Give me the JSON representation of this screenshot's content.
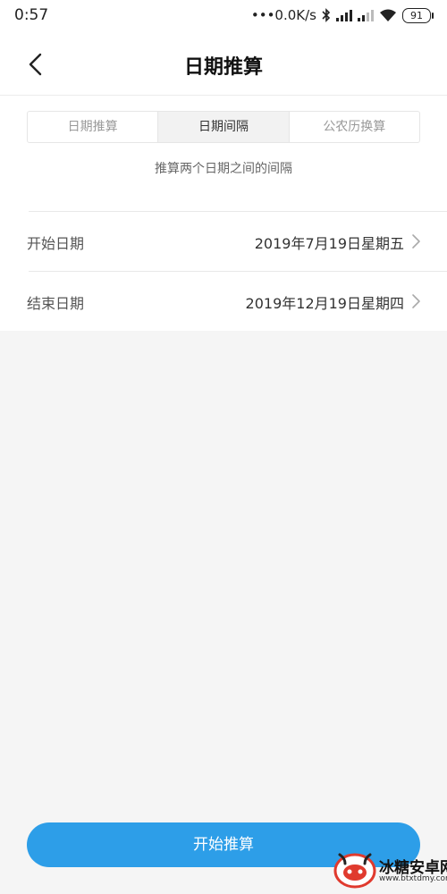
{
  "status_bar": {
    "time": "0:57",
    "speed": "•••0.0K/s",
    "battery": "91"
  },
  "header": {
    "title": "日期推算"
  },
  "tabs": [
    {
      "label": "日期推算",
      "active": false
    },
    {
      "label": "日期间隔",
      "active": true
    },
    {
      "label": "公农历换算",
      "active": false
    }
  ],
  "subtitle": "推算两个日期之间的间隔",
  "rows": {
    "start": {
      "label": "开始日期",
      "value": "2019年7月19日星期五"
    },
    "end": {
      "label": "结束日期",
      "value": "2019年12月19日星期四"
    }
  },
  "action": {
    "start_label": "开始推算"
  },
  "watermark": {
    "name": "冰糖安卓网",
    "url": "www.btxtdmy.com"
  },
  "colors": {
    "accent": "#2d9ee8",
    "background": "#f5f5f5"
  }
}
